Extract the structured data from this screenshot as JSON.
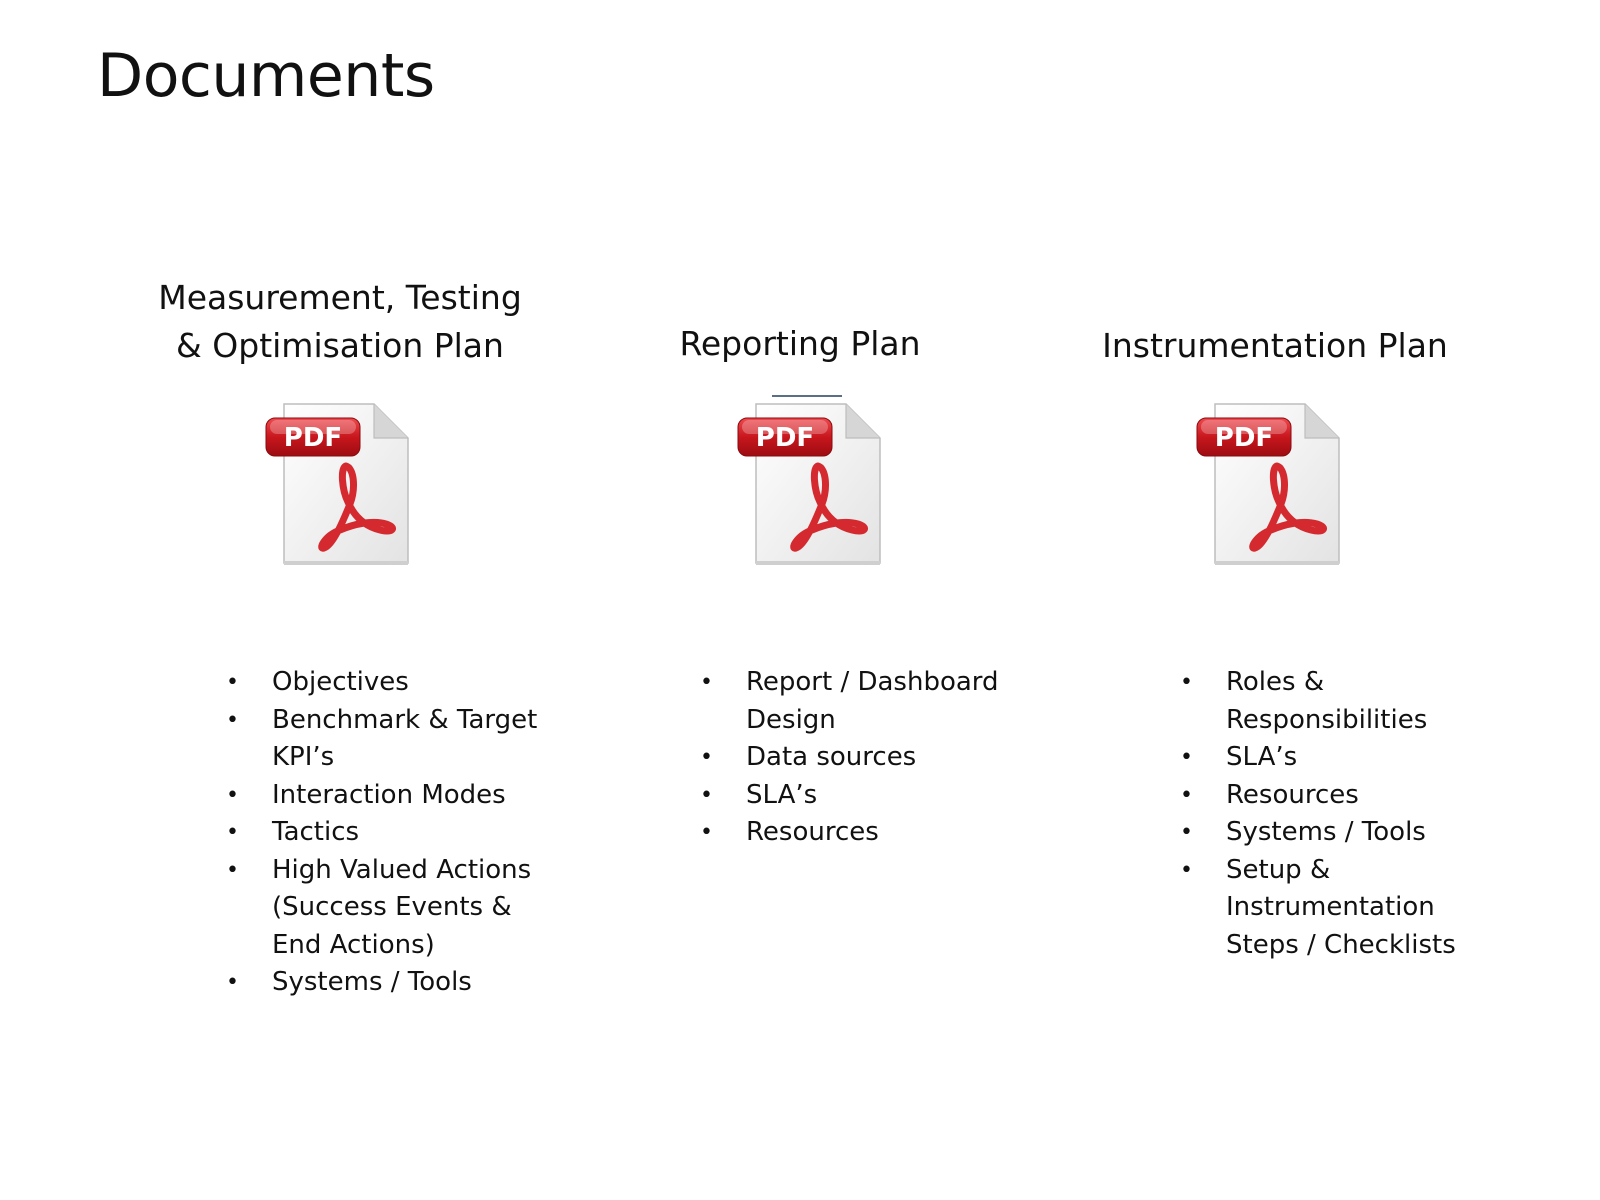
{
  "title": "Documents",
  "documents": [
    {
      "heading_lines": [
        "Measurement, Testing",
        "& Optimisation Plan"
      ],
      "icon": "pdf-file-icon",
      "icon_label": "PDF",
      "items": [
        "Objectives",
        "Benchmark & Target KPI’s",
        "Interaction Modes",
        "Tactics",
        "High Valued Actions (Success Events & End Actions)",
        "Systems / Tools"
      ]
    },
    {
      "heading_lines": [
        "Reporting Plan"
      ],
      "icon": "pdf-file-icon",
      "icon_label": "PDF",
      "items": [
        "Report / Dashboard Design",
        "Data sources",
        "SLA’s",
        "Resources"
      ]
    },
    {
      "heading_lines": [
        "Instrumentation Plan"
      ],
      "icon": "pdf-file-icon",
      "icon_label": "PDF",
      "items": [
        "Roles & Responsibilities",
        "SLA’s",
        "Resources",
        "Systems / Tools",
        "Setup & Instrumentation Steps / Checklists"
      ]
    }
  ],
  "colors": {
    "pdf_badge": "#c8161d",
    "acrobat_logo": "#d42a2f",
    "page_text": "#111111"
  }
}
